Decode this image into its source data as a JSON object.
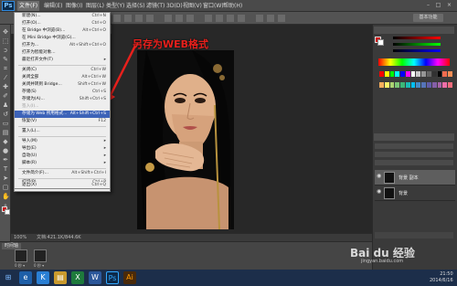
{
  "app": {
    "logo": "Ps"
  },
  "menubar": {
    "items": [
      "文件(F)",
      "编辑(E)",
      "图像(I)",
      "图层(L)",
      "类型(Y)",
      "选择(S)",
      "滤镜(T)",
      "3D(D)",
      "视图(V)",
      "窗口(W)",
      "帮助(H)"
    ],
    "window_buttons": [
      "–",
      "□",
      "×"
    ]
  },
  "options": {
    "workspace": "基本功能"
  },
  "file_menu": {
    "items": [
      {
        "label": "新建(N)...",
        "shortcut": "Ctrl+N"
      },
      {
        "label": "打开(O)...",
        "shortcut": "Ctrl+O"
      },
      {
        "label": "在 Bridge 中浏览(B)...",
        "shortcut": "Alt+Ctrl+O"
      },
      {
        "label": "在 Mini Bridge 中浏览(G)...",
        "shortcut": ""
      },
      {
        "label": "打开为...",
        "shortcut": "Alt+Shift+Ctrl+O"
      },
      {
        "label": "打开为智能对象...",
        "shortcut": ""
      },
      {
        "label": "最近打开文件(T)",
        "shortcut": "▸"
      },
      {
        "label": "关闭(C)",
        "shortcut": "Ctrl+W"
      },
      {
        "label": "关闭全部",
        "shortcut": "Alt+Ctrl+W"
      },
      {
        "label": "关闭并转到 Bridge...",
        "shortcut": "Shift+Ctrl+W"
      },
      {
        "label": "存储(S)",
        "shortcut": "Ctrl+S"
      },
      {
        "label": "存储为(A)...",
        "shortcut": "Shift+Ctrl+S"
      },
      {
        "label": "签入(I)...",
        "shortcut": ""
      },
      {
        "label": "存储为 Web 所用格式...",
        "shortcut": "Alt+Shift+Ctrl+S"
      },
      {
        "label": "恢复(V)",
        "shortcut": "F12"
      },
      {
        "label": "置入(L)...",
        "shortcut": ""
      },
      {
        "label": "导入(M)",
        "shortcut": "▸"
      },
      {
        "label": "导出(E)",
        "shortcut": "▸"
      },
      {
        "label": "自动(U)",
        "shortcut": "▸"
      },
      {
        "label": "脚本(R)",
        "shortcut": "▸"
      },
      {
        "label": "文件简介(F)...",
        "shortcut": "Alt+Shift+Ctrl+I"
      },
      {
        "label": "打印(P)...",
        "shortcut": "Ctrl+P"
      },
      {
        "label": "打印一份(Y)",
        "shortcut": "Alt+Shift+Ctrl+P"
      },
      {
        "label": "退出(X)",
        "shortcut": "Ctrl+Q"
      }
    ]
  },
  "annotation": "另存为WEB格式",
  "status": {
    "zoom": "100%",
    "doc": "文档:421.1K/844.6K"
  },
  "timeline": {
    "tab": "时间轴",
    "frames": [
      "0 秒 ▾",
      "0 秒 ▾"
    ]
  },
  "layers": [
    {
      "name": "背景 副本",
      "selected": true
    },
    {
      "name": "背景",
      "selected": false
    }
  ],
  "watermark": {
    "text": "Bai du 经验",
    "sub": "jingyan.baidu.com"
  },
  "taskbar": {
    "time": "21:50",
    "date": "2014/6/16",
    "icons": [
      "win-start",
      "ie",
      "k-app",
      "explorer",
      "excel",
      "word",
      "photoshop",
      "illustrator"
    ]
  }
}
